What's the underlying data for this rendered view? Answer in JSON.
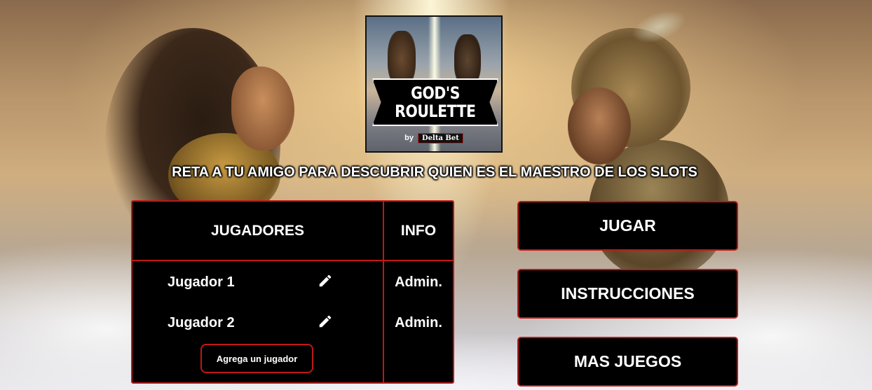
{
  "logo": {
    "title_line1": "GOD'S",
    "title_line2": "ROULETTE",
    "by": "by",
    "brand": "Delta Bet"
  },
  "tagline": "RETA A TU AMIGO PARA DESCUBRIR QUIEN ES EL MAESTRO DE LOS SLOTS",
  "players_table": {
    "header_players": "JUGADORES",
    "header_info": "INFO",
    "rows": [
      {
        "name": "Jugador 1",
        "role": "Admin.",
        "edit_icon": "pencil-icon"
      },
      {
        "name": "Jugador 2",
        "role": "Admin.",
        "edit_icon": "pencil-icon"
      }
    ],
    "add_player_label": "Agrega un jugador"
  },
  "menu": {
    "play": "JUGAR",
    "instructions": "INSTRUCCIONES",
    "more_games": "MAS JUEGOS"
  },
  "colors": {
    "accent": "#c01818",
    "panel_bg": "#000000",
    "text": "#ffffff"
  }
}
